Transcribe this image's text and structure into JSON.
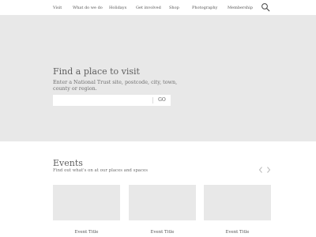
{
  "nav": {
    "items": [
      {
        "label": "Visit"
      },
      {
        "label": "What do we do"
      },
      {
        "label": "Holidays"
      },
      {
        "label": "Get involved"
      },
      {
        "label": "Shop"
      },
      {
        "label": "Photography"
      },
      {
        "label": "Membership"
      }
    ],
    "search_icon": "search-icon"
  },
  "hero": {
    "title": "Find a place to visit",
    "description": "Enter a National Trust site, postcode, city, town, county or region.",
    "search": {
      "value": "",
      "placeholder": ""
    },
    "go_label": "GO"
  },
  "events": {
    "title": "Events",
    "subtitle": "Find out what's on at our places and spaces",
    "prev_icon": "chevron-left-icon",
    "next_icon": "chevron-right-icon",
    "cards": [
      {
        "title": "Event Title"
      },
      {
        "title": "Event Title"
      },
      {
        "title": "Event Title"
      }
    ]
  },
  "colors": {
    "placeholder_gray": "#e8e8e8",
    "text": "#555555",
    "arrow": "#bbbbbb"
  }
}
